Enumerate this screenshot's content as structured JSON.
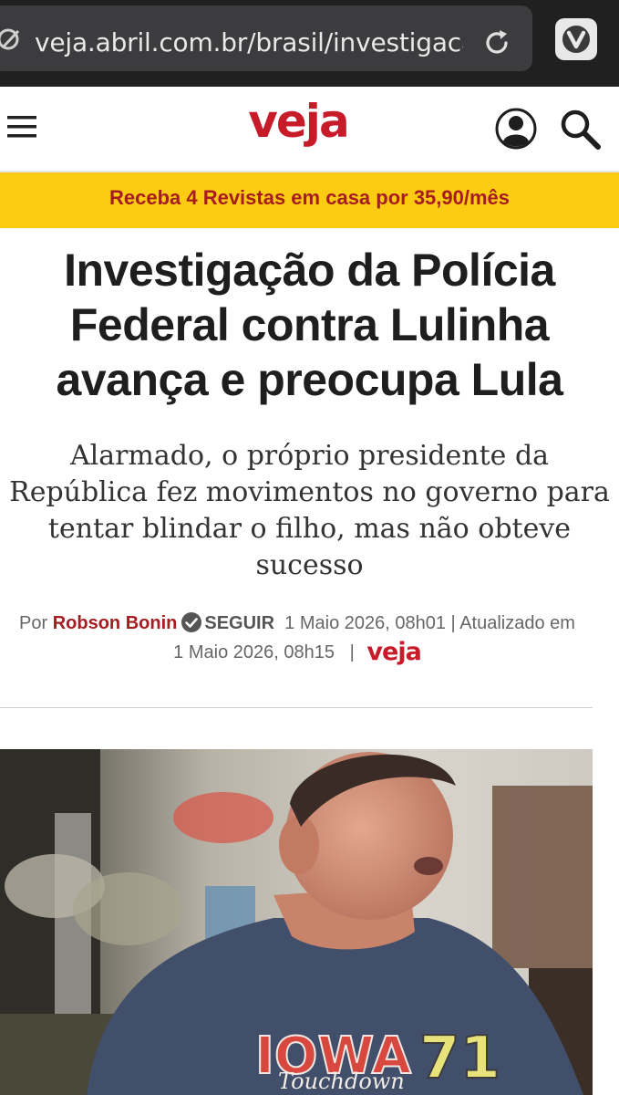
{
  "browser": {
    "url": "veja.abril.com.br/brasil/investigacao",
    "colors": {
      "toolbar": "#202020",
      "url_field": "#3c3c3e"
    }
  },
  "header": {
    "logo": "veja",
    "icons": [
      "menu-icon",
      "user-icon",
      "search-icon"
    ]
  },
  "promo": {
    "text": "Receba 4 Revistas em casa por 35,90/mês",
    "colors": {
      "background": "#fccc12",
      "text": "#a51c21"
    }
  },
  "article": {
    "headline": "Investigação da Polícia Federal contra Lulinha avança e preocupa Lula",
    "subtitle": "Alarmado, o próprio presidente da República fez movimentos no governo para tentar blindar o filho, mas não obteve sucesso",
    "byline": {
      "prefix": "Por",
      "author": "Robson Bonin",
      "follow": "SEGUIR",
      "published": "1 Maio 2026, 08h01",
      "separator": "|",
      "updated_label": "Atualizado em",
      "updated": "1 Maio 2026, 08h15",
      "logo": "veja"
    }
  },
  "colors": {
    "brand_red": "#c81b2a"
  }
}
